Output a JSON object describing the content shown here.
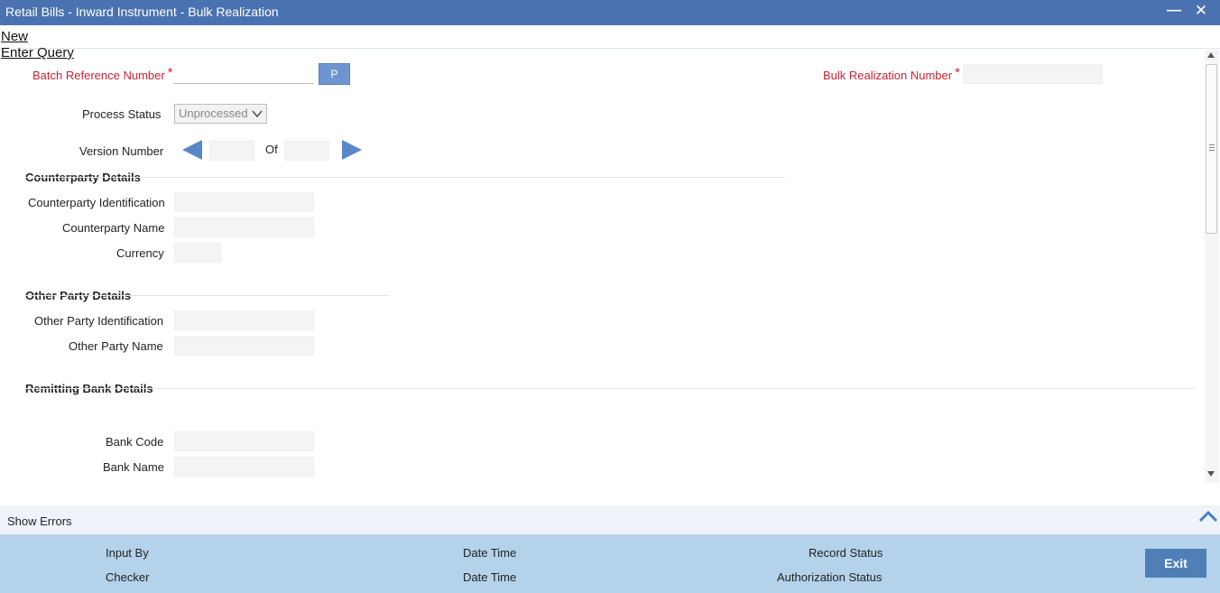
{
  "window": {
    "title": "Retail Bills - Inward Instrument - Bulk Realization"
  },
  "menu": {
    "new": "New",
    "enter_query": "Enter Query"
  },
  "form": {
    "batch_ref_label": "Batch Reference Number",
    "required_mark": "*",
    "p_button": "P",
    "bulk_realization_label": "Bulk Realization Number",
    "process_status_label": "Process Status",
    "process_status_value": "Unprocessed",
    "version_number_label": "Version Number",
    "of_label": "Of"
  },
  "sections": {
    "counterparty": {
      "title": "Counterparty Details",
      "identification": "Counterparty Identification",
      "name": "Counterparty Name",
      "currency": "Currency"
    },
    "other_party": {
      "title": "Other Party Details",
      "identification": "Other Party Identification",
      "name": "Other Party Name"
    },
    "remitting_bank": {
      "title": "Remitting Bank Details",
      "bank_code": "Bank Code",
      "bank_name": "Bank Name"
    }
  },
  "errors": {
    "show_errors": "Show Errors"
  },
  "footer": {
    "input_by": "Input By",
    "checker": "Checker",
    "date_time_1": "Date Time",
    "date_time_2": "Date Time",
    "record_status": "Record Status",
    "authorization_status": "Authorization Status",
    "exit": "Exit"
  },
  "colors": {
    "titlebar": "#4a72b0",
    "required_label": "#cc2233",
    "accent_button": "#6f95d1",
    "footer": "#b4d2ea",
    "exit_button": "#4f7fb6"
  },
  "icons": {
    "minimize": "minimize-icon",
    "close": "close-icon",
    "prev_version": "arrow-left-icon",
    "next_version": "arrow-right-icon",
    "expand_errors": "chevron-up-icon"
  }
}
